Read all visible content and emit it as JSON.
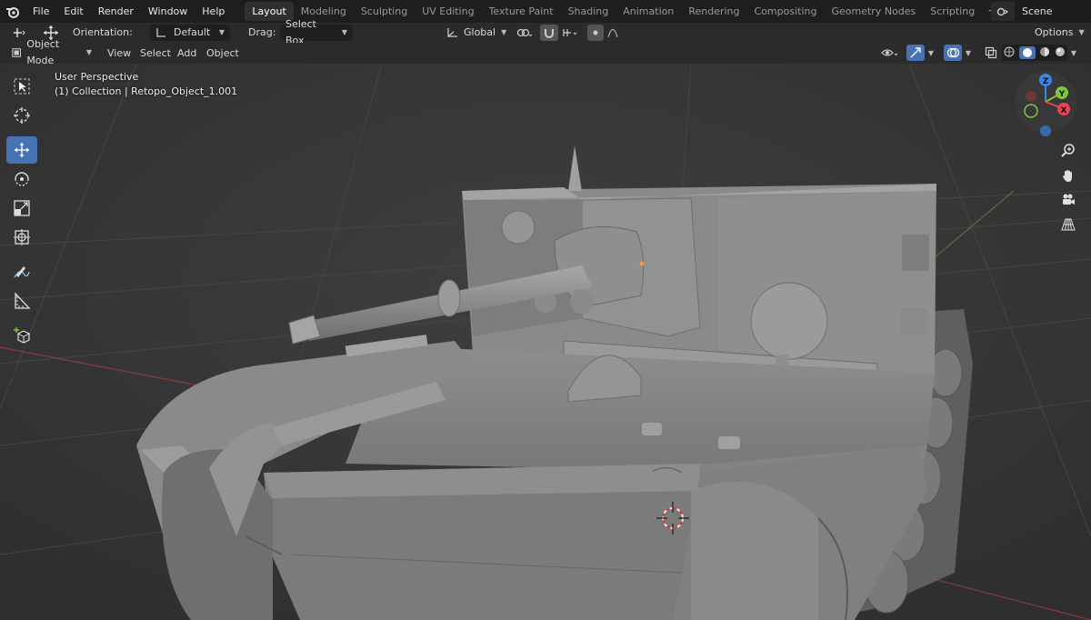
{
  "menu": {
    "items": [
      "File",
      "Edit",
      "Render",
      "Window",
      "Help"
    ]
  },
  "workspaces": {
    "tabs": [
      "Layout",
      "Modeling",
      "Sculpting",
      "UV Editing",
      "Texture Paint",
      "Shading",
      "Animation",
      "Rendering",
      "Compositing",
      "Geometry Nodes",
      "Scripting"
    ],
    "active": "Layout",
    "add_label": "+"
  },
  "scene": {
    "name": "Scene"
  },
  "tool_settings": {
    "orientation_label": "Orientation:",
    "orientation_value": "Default",
    "drag_label": "Drag:",
    "drag_value": "Select Box",
    "transform_orientation": "Global",
    "options_label": "Options"
  },
  "header": {
    "mode": "Object Mode",
    "menus": [
      "View",
      "Select",
      "Add",
      "Object"
    ]
  },
  "viewport": {
    "perspective_label": "User Perspective",
    "collection_label": "(1) Collection | Retopo_Object_1.001"
  },
  "gizmo": {
    "z": "Z",
    "y": "Y",
    "x": "X"
  },
  "colors": {
    "accent": "#4772b3",
    "axis_x": "#e8474f",
    "axis_y": "#7ec73b",
    "axis_z": "#3b84e8"
  }
}
